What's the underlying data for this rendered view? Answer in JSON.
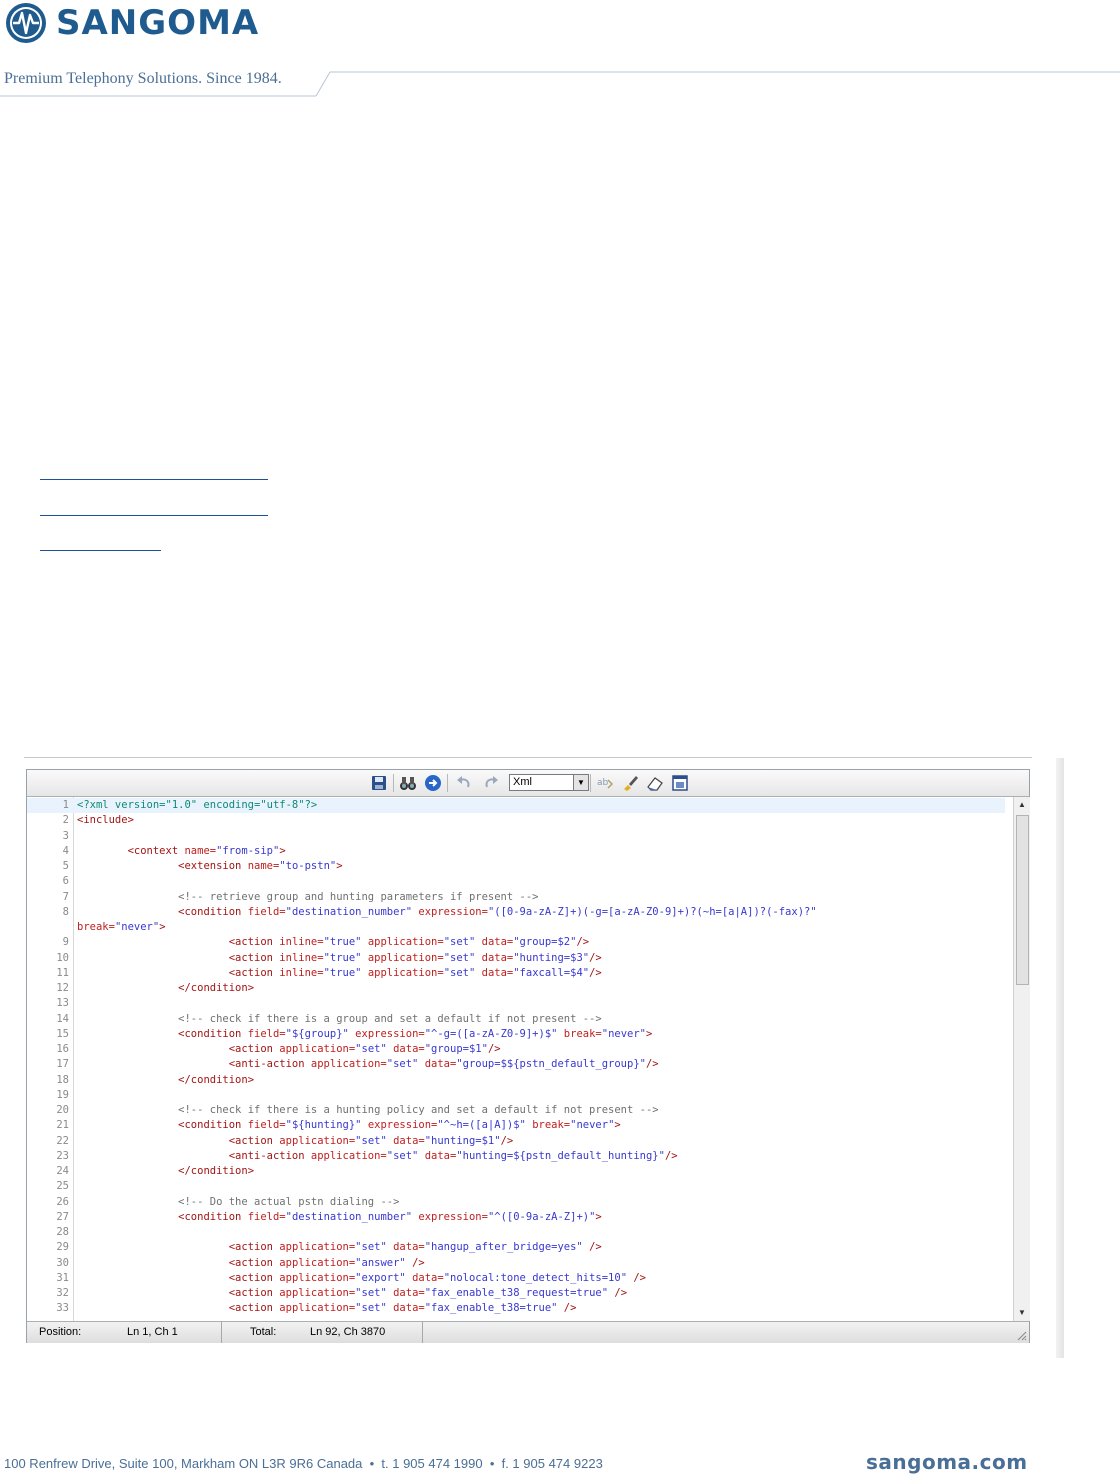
{
  "header": {
    "brand": "SANGOMA",
    "tagline": "Premium Telephony Solutions. Since 1984."
  },
  "editor": {
    "language": "Xml",
    "lines": [
      {
        "n": "1",
        "tokens": [
          {
            "c": "pi",
            "t": "<?xml version=\"1.0\" encoding=\"utf-8\"?>"
          }
        ]
      },
      {
        "n": "2",
        "tokens": [
          {
            "c": "tag",
            "t": "<include>"
          }
        ]
      },
      {
        "n": "3",
        "tokens": []
      },
      {
        "n": "4",
        "tokens": [
          {
            "c": "pl",
            "t": "        "
          },
          {
            "c": "tag",
            "t": "<context"
          },
          {
            "c": "attr",
            "t": " name="
          },
          {
            "c": "val",
            "t": "\"from-sip\""
          },
          {
            "c": "tag",
            "t": ">"
          }
        ]
      },
      {
        "n": "5",
        "tokens": [
          {
            "c": "pl",
            "t": "                "
          },
          {
            "c": "tag",
            "t": "<extension"
          },
          {
            "c": "attr",
            "t": " name="
          },
          {
            "c": "val",
            "t": "\"to-pstn\""
          },
          {
            "c": "tag",
            "t": ">"
          }
        ]
      },
      {
        "n": "6",
        "tokens": []
      },
      {
        "n": "7",
        "tokens": [
          {
            "c": "pl",
            "t": "                "
          },
          {
            "c": "cm",
            "t": "<!-- retrieve group and hunting parameters if present -->"
          }
        ]
      },
      {
        "n": "8",
        "tokens": [
          {
            "c": "pl",
            "t": "                "
          },
          {
            "c": "tag",
            "t": "<condition"
          },
          {
            "c": "attr",
            "t": " field="
          },
          {
            "c": "val",
            "t": "\"destination_number\""
          },
          {
            "c": "attr",
            "t": " expression="
          },
          {
            "c": "val",
            "t": "\"([0-9a-zA-Z]+)(-g=[a-zA-Z0-9]+)?(~h=[a|A])?(-fax)?\""
          }
        ]
      },
      {
        "n": "",
        "tokens": [
          {
            "c": "attr",
            "t": "break="
          },
          {
            "c": "val",
            "t": "\"never\""
          },
          {
            "c": "tag",
            "t": ">"
          }
        ]
      },
      {
        "n": "9",
        "tokens": [
          {
            "c": "pl",
            "t": "                        "
          },
          {
            "c": "tag",
            "t": "<action"
          },
          {
            "c": "attr",
            "t": " inline="
          },
          {
            "c": "val",
            "t": "\"true\""
          },
          {
            "c": "attr",
            "t": " application="
          },
          {
            "c": "val",
            "t": "\"set\""
          },
          {
            "c": "attr",
            "t": " data="
          },
          {
            "c": "val",
            "t": "\"group=$2\""
          },
          {
            "c": "tag",
            "t": "/>"
          }
        ]
      },
      {
        "n": "10",
        "tokens": [
          {
            "c": "pl",
            "t": "                        "
          },
          {
            "c": "tag",
            "t": "<action"
          },
          {
            "c": "attr",
            "t": " inline="
          },
          {
            "c": "val",
            "t": "\"true\""
          },
          {
            "c": "attr",
            "t": " application="
          },
          {
            "c": "val",
            "t": "\"set\""
          },
          {
            "c": "attr",
            "t": " data="
          },
          {
            "c": "val",
            "t": "\"hunting=$3\""
          },
          {
            "c": "tag",
            "t": "/>"
          }
        ]
      },
      {
        "n": "11",
        "tokens": [
          {
            "c": "pl",
            "t": "                        "
          },
          {
            "c": "tag",
            "t": "<action"
          },
          {
            "c": "attr",
            "t": " inline="
          },
          {
            "c": "val",
            "t": "\"true\""
          },
          {
            "c": "attr",
            "t": " application="
          },
          {
            "c": "val",
            "t": "\"set\""
          },
          {
            "c": "attr",
            "t": " data="
          },
          {
            "c": "val",
            "t": "\"faxcall=$4\""
          },
          {
            "c": "tag",
            "t": "/>"
          }
        ]
      },
      {
        "n": "12",
        "tokens": [
          {
            "c": "pl",
            "t": "                "
          },
          {
            "c": "tag",
            "t": "</condition>"
          }
        ]
      },
      {
        "n": "13",
        "tokens": []
      },
      {
        "n": "14",
        "tokens": [
          {
            "c": "pl",
            "t": "                "
          },
          {
            "c": "cm",
            "t": "<!-- check if there is a group and set a default if not present -->"
          }
        ]
      },
      {
        "n": "15",
        "tokens": [
          {
            "c": "pl",
            "t": "                "
          },
          {
            "c": "tag",
            "t": "<condition"
          },
          {
            "c": "attr",
            "t": " field="
          },
          {
            "c": "val",
            "t": "\"${group}\""
          },
          {
            "c": "attr",
            "t": " expression="
          },
          {
            "c": "val",
            "t": "\"^-g=([a-zA-Z0-9]+)$\""
          },
          {
            "c": "attr",
            "t": " break="
          },
          {
            "c": "val",
            "t": "\"never\""
          },
          {
            "c": "tag",
            "t": ">"
          }
        ]
      },
      {
        "n": "16",
        "tokens": [
          {
            "c": "pl",
            "t": "                        "
          },
          {
            "c": "tag",
            "t": "<action"
          },
          {
            "c": "attr",
            "t": " application="
          },
          {
            "c": "val",
            "t": "\"set\""
          },
          {
            "c": "attr",
            "t": " data="
          },
          {
            "c": "val",
            "t": "\"group=$1\""
          },
          {
            "c": "tag",
            "t": "/>"
          }
        ]
      },
      {
        "n": "17",
        "tokens": [
          {
            "c": "pl",
            "t": "                        "
          },
          {
            "c": "tag",
            "t": "<anti-action"
          },
          {
            "c": "attr",
            "t": " application="
          },
          {
            "c": "val",
            "t": "\"set\""
          },
          {
            "c": "attr",
            "t": " data="
          },
          {
            "c": "val",
            "t": "\"group=$${pstn_default_group}\""
          },
          {
            "c": "tag",
            "t": "/>"
          }
        ]
      },
      {
        "n": "18",
        "tokens": [
          {
            "c": "pl",
            "t": "                "
          },
          {
            "c": "tag",
            "t": "</condition>"
          }
        ]
      },
      {
        "n": "19",
        "tokens": []
      },
      {
        "n": "20",
        "tokens": [
          {
            "c": "pl",
            "t": "                "
          },
          {
            "c": "cm",
            "t": "<!-- check if there is a hunting policy and set a default if not present -->"
          }
        ]
      },
      {
        "n": "21",
        "tokens": [
          {
            "c": "pl",
            "t": "                "
          },
          {
            "c": "tag",
            "t": "<condition"
          },
          {
            "c": "attr",
            "t": " field="
          },
          {
            "c": "val",
            "t": "\"${hunting}\""
          },
          {
            "c": "attr",
            "t": " expression="
          },
          {
            "c": "val",
            "t": "\"^~h=([a|A])$\""
          },
          {
            "c": "attr",
            "t": " break="
          },
          {
            "c": "val",
            "t": "\"never\""
          },
          {
            "c": "tag",
            "t": ">"
          }
        ]
      },
      {
        "n": "22",
        "tokens": [
          {
            "c": "pl",
            "t": "                        "
          },
          {
            "c": "tag",
            "t": "<action"
          },
          {
            "c": "attr",
            "t": " application="
          },
          {
            "c": "val",
            "t": "\"set\""
          },
          {
            "c": "attr",
            "t": " data="
          },
          {
            "c": "val",
            "t": "\"hunting=$1\""
          },
          {
            "c": "tag",
            "t": "/>"
          }
        ]
      },
      {
        "n": "23",
        "tokens": [
          {
            "c": "pl",
            "t": "                        "
          },
          {
            "c": "tag",
            "t": "<anti-action"
          },
          {
            "c": "attr",
            "t": " application="
          },
          {
            "c": "val",
            "t": "\"set\""
          },
          {
            "c": "attr",
            "t": " data="
          },
          {
            "c": "val",
            "t": "\"hunting=${pstn_default_hunting}\""
          },
          {
            "c": "tag",
            "t": "/>"
          }
        ]
      },
      {
        "n": "24",
        "tokens": [
          {
            "c": "pl",
            "t": "                "
          },
          {
            "c": "tag",
            "t": "</condition>"
          }
        ]
      },
      {
        "n": "25",
        "tokens": []
      },
      {
        "n": "26",
        "tokens": [
          {
            "c": "pl",
            "t": "                "
          },
          {
            "c": "cm",
            "t": "<!-- Do the actual pstn dialing -->"
          }
        ]
      },
      {
        "n": "27",
        "tokens": [
          {
            "c": "pl",
            "t": "                "
          },
          {
            "c": "tag",
            "t": "<condition"
          },
          {
            "c": "attr",
            "t": " field="
          },
          {
            "c": "val",
            "t": "\"destination_number\""
          },
          {
            "c": "attr",
            "t": " expression="
          },
          {
            "c": "val",
            "t": "\"^([0-9a-zA-Z]+)\""
          },
          {
            "c": "tag",
            "t": ">"
          }
        ]
      },
      {
        "n": "28",
        "tokens": []
      },
      {
        "n": "29",
        "tokens": [
          {
            "c": "pl",
            "t": "                        "
          },
          {
            "c": "tag",
            "t": "<action"
          },
          {
            "c": "attr",
            "t": " application="
          },
          {
            "c": "val",
            "t": "\"set\""
          },
          {
            "c": "attr",
            "t": " data="
          },
          {
            "c": "val",
            "t": "\"hangup_after_bridge=yes\""
          },
          {
            "c": "tag",
            "t": " />"
          }
        ]
      },
      {
        "n": "30",
        "tokens": [
          {
            "c": "pl",
            "t": "                        "
          },
          {
            "c": "tag",
            "t": "<action"
          },
          {
            "c": "attr",
            "t": " application="
          },
          {
            "c": "val",
            "t": "\"answer\""
          },
          {
            "c": "tag",
            "t": " />"
          }
        ]
      },
      {
        "n": "31",
        "tokens": [
          {
            "c": "pl",
            "t": "                        "
          },
          {
            "c": "tag",
            "t": "<action"
          },
          {
            "c": "attr",
            "t": " application="
          },
          {
            "c": "val",
            "t": "\"export\""
          },
          {
            "c": "attr",
            "t": " data="
          },
          {
            "c": "val",
            "t": "\"nolocal:tone_detect_hits=10\""
          },
          {
            "c": "tag",
            "t": " />"
          }
        ]
      },
      {
        "n": "32",
        "tokens": [
          {
            "c": "pl",
            "t": "                        "
          },
          {
            "c": "tag",
            "t": "<action"
          },
          {
            "c": "attr",
            "t": " application="
          },
          {
            "c": "val",
            "t": "\"set\""
          },
          {
            "c": "attr",
            "t": " data="
          },
          {
            "c": "val",
            "t": "\"fax_enable_t38_request=true\""
          },
          {
            "c": "tag",
            "t": " />"
          }
        ]
      },
      {
        "n": "33",
        "tokens": [
          {
            "c": "pl",
            "t": "                        "
          },
          {
            "c": "tag",
            "t": "<action"
          },
          {
            "c": "attr",
            "t": " application="
          },
          {
            "c": "val",
            "t": "\"set\""
          },
          {
            "c": "attr",
            "t": " data="
          },
          {
            "c": "val",
            "t": "\"fax_enable_t38=true\""
          },
          {
            "c": "tag",
            "t": " />"
          }
        ]
      }
    ],
    "status": {
      "position_label": "Position:",
      "position_value": "Ln 1, Ch 1",
      "total_label": "Total:",
      "total_value": "Ln 92, Ch 3870"
    }
  },
  "footer": {
    "address": "100 Renfrew Drive, Suite 100, Markham ON L3R 9R6 Canada  •  t. 1 905 474 1990  •  f. 1 905 474 9223",
    "site": "sangoma.com"
  },
  "colors": {
    "brand": "#1f5b8e",
    "tagline": "#4a6f96",
    "link_rule": "#1f4f9a"
  }
}
